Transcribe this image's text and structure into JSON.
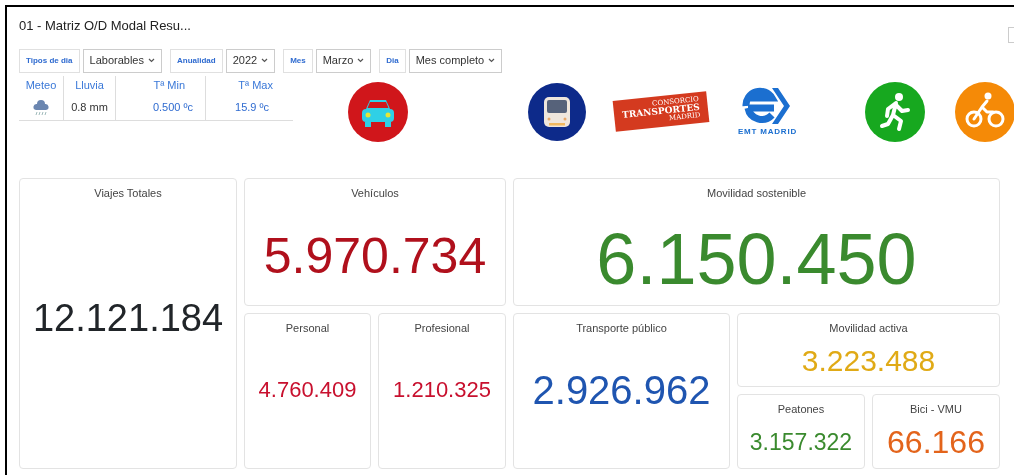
{
  "panel": {
    "title": "01 - Matriz O/D Modal Resu..."
  },
  "filters": [
    {
      "label": "Tipos de dia",
      "value": "Laborables"
    },
    {
      "label": "Anualidad",
      "value": "2022"
    },
    {
      "label": "Mes",
      "value": "Marzo"
    },
    {
      "label": "Dia",
      "value": "Mes completo"
    }
  ],
  "weather": {
    "headers": [
      "Meteo",
      "Lluvia",
      "Tª Min",
      "Tª Max"
    ],
    "rain": "0.8 mm",
    "tmin": "0.500 ºc",
    "tmax": "15.9 ºc"
  },
  "logos": [
    {
      "kind": "car",
      "color": "#d0161b"
    },
    {
      "kind": "train",
      "color": "#0d2a8a"
    },
    {
      "kind": "consorcio",
      "lines": [
        "CONSORCIO",
        "TRANSPORTES",
        "MADRID"
      ]
    },
    {
      "kind": "emt",
      "text": "EMT MADRID"
    },
    {
      "kind": "walk",
      "color": "#17a81f"
    },
    {
      "kind": "bike",
      "color": "#f58a07"
    }
  ],
  "cards": [
    {
      "title": "Viajes Totales",
      "value": "12.121.184",
      "color": "#212529"
    },
    {
      "title": "Vehículos",
      "value": "5.970.734",
      "color": "#b0101c"
    },
    {
      "title": "Personal",
      "value": "4.760.409",
      "color": "#c8102e"
    },
    {
      "title": "Profesional",
      "value": "1.210.325",
      "color": "#c8102e"
    },
    {
      "title": "Movilidad sostenible",
      "value": "6.150.450",
      "color": "#3a8a2e"
    },
    {
      "title": "Transporte público",
      "value": "2.926.962",
      "color": "#1f55b0"
    },
    {
      "title": "Movilidad activa",
      "value": "3.223.488",
      "color": "#e0aa16"
    },
    {
      "title": "Peatones",
      "value": "3.157.322",
      "color": "#3a8a2e"
    },
    {
      "title": "Bici - VMU",
      "value": "66.166",
      "color": "#e3641b"
    }
  ]
}
